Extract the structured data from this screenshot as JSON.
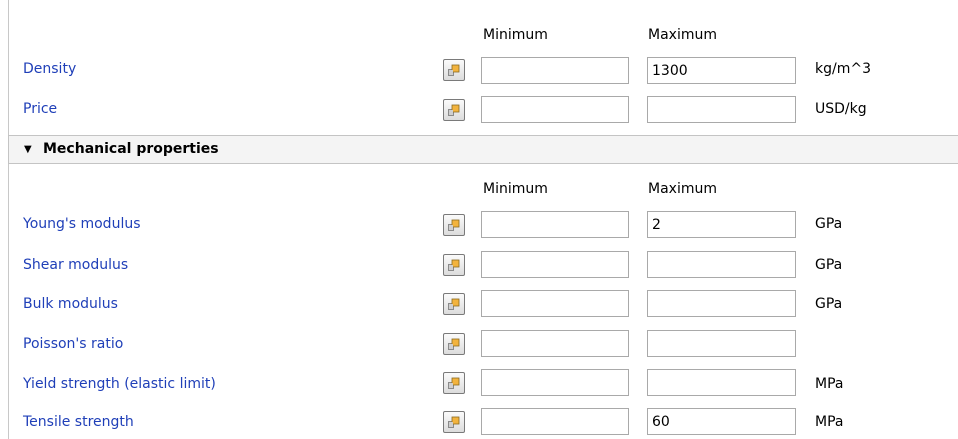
{
  "columns": {
    "minimum": "Minimum",
    "maximum": "Maximum"
  },
  "general_rows": [
    {
      "label": "Density",
      "min": "",
      "max": "1300",
      "unit": "kg/m^3"
    },
    {
      "label": "Price",
      "min": "",
      "max": "",
      "unit": "USD/kg"
    }
  ],
  "section": {
    "title": "Mechanical properties",
    "expanded": true
  },
  "mechanical_rows": [
    {
      "label": "Young's modulus",
      "min": "",
      "max": "2",
      "unit": "GPa"
    },
    {
      "label": "Shear modulus",
      "min": "",
      "max": "",
      "unit": "GPa"
    },
    {
      "label": "Bulk modulus",
      "min": "",
      "max": "",
      "unit": "GPa"
    },
    {
      "label": "Poisson's ratio",
      "min": "",
      "max": "",
      "unit": ""
    },
    {
      "label": "Yield strength (elastic limit)",
      "min": "",
      "max": "",
      "unit": "MPa"
    },
    {
      "label": "Tensile strength",
      "min": "",
      "max": "60",
      "unit": "MPa"
    }
  ],
  "icons": {
    "select_button": "select-range-icon",
    "section_toggle": "triangle-down-icon"
  },
  "colors": {
    "label_link": "#1f3fb8",
    "section_bg": "#f4f4f4",
    "field_border": "#a9a9a9"
  }
}
